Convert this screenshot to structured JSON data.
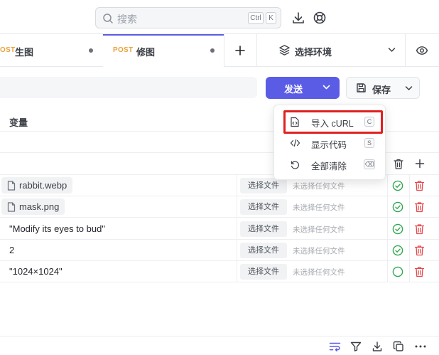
{
  "search": {
    "placeholder": "搜索",
    "shortcut_ctrl": "Ctrl",
    "shortcut_key": "K"
  },
  "tabs": [
    {
      "method": "OST",
      "name": "生图"
    },
    {
      "method": "POST",
      "name": "修图"
    }
  ],
  "environment": {
    "label": "选择环境"
  },
  "actions": {
    "send_label": "发送",
    "save_label": "保存"
  },
  "table": {
    "header_variable": "变量",
    "choose_file_label": "选择文件",
    "no_file_label": "未选择任何文件",
    "rows": [
      {
        "value": "rabbit.webp",
        "type": "file",
        "enabled": true
      },
      {
        "value": "mask.png",
        "type": "file",
        "enabled": true
      },
      {
        "value": "\"Modify its eyes to bud\"",
        "type": "text",
        "enabled": true
      },
      {
        "value": "2",
        "type": "text",
        "enabled": true
      },
      {
        "value": "\"1024×1024\"",
        "type": "text",
        "enabled": false
      }
    ]
  },
  "send_menu": {
    "items": [
      {
        "label": "导入 cURL",
        "shortcut": "C",
        "icon": "file-code-icon"
      },
      {
        "label": "显示代码",
        "shortcut": "S",
        "icon": "code-icon"
      },
      {
        "label": "全部清除",
        "shortcut": "⌫",
        "icon": "reset-icon"
      }
    ]
  },
  "colors": {
    "accent": "#5b5ce6",
    "method_post": "#e8a33d",
    "ok_green": "#2fa84f",
    "delete_red": "#e5484d",
    "highlight": "#e02020"
  }
}
